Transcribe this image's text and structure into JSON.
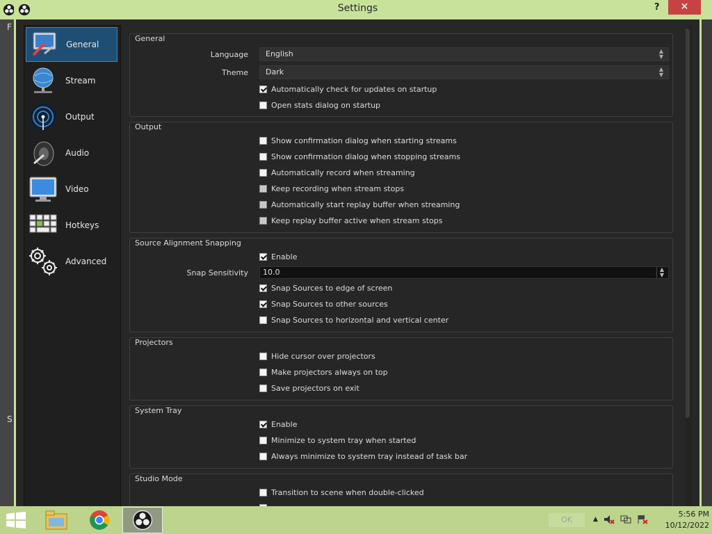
{
  "window": {
    "title": "Settings",
    "help_label": "?",
    "close_label": "✕",
    "background_menu_initial": "F",
    "background_dock_initial": "S"
  },
  "sidebar": {
    "items": [
      {
        "label": "General",
        "icon": "general-icon",
        "active": true
      },
      {
        "label": "Stream",
        "icon": "stream-globe-icon"
      },
      {
        "label": "Output",
        "icon": "output-signal-icon"
      },
      {
        "label": "Audio",
        "icon": "audio-speaker-icon"
      },
      {
        "label": "Video",
        "icon": "video-monitor-icon"
      },
      {
        "label": "Hotkeys",
        "icon": "hotkeys-keyboard-icon"
      },
      {
        "label": "Advanced",
        "icon": "advanced-gears-icon"
      }
    ]
  },
  "general": {
    "title": "General",
    "language_label": "Language",
    "language_value": "English",
    "theme_label": "Theme",
    "theme_value": "Dark",
    "check_updates": {
      "label": "Automatically check for updates on startup",
      "checked": true
    },
    "open_stats": {
      "label": "Open stats dialog on startup",
      "checked": false
    }
  },
  "output": {
    "title": "Output",
    "items": [
      {
        "label": "Show confirmation dialog when starting streams",
        "checked": false,
        "disabled": false
      },
      {
        "label": "Show confirmation dialog when stopping streams",
        "checked": false,
        "disabled": false
      },
      {
        "label": "Automatically record when streaming",
        "checked": false,
        "disabled": false
      },
      {
        "label": "Keep recording when stream stops",
        "checked": false,
        "disabled": true
      },
      {
        "label": "Automatically start replay buffer when streaming",
        "checked": false,
        "disabled": true
      },
      {
        "label": "Keep replay buffer active when stream stops",
        "checked": false,
        "disabled": true
      }
    ]
  },
  "snapping": {
    "title": "Source Alignment Snapping",
    "enable": {
      "label": "Enable",
      "checked": true
    },
    "sensitivity_label": "Snap Sensitivity",
    "sensitivity_value": "10.0",
    "items": [
      {
        "label": "Snap Sources to edge of screen",
        "checked": true
      },
      {
        "label": "Snap Sources to other sources",
        "checked": true
      },
      {
        "label": "Snap Sources to horizontal and vertical center",
        "checked": false
      }
    ]
  },
  "projectors": {
    "title": "Projectors",
    "items": [
      {
        "label": "Hide cursor over projectors",
        "checked": false
      },
      {
        "label": "Make projectors always on top",
        "checked": false
      },
      {
        "label": "Save projectors on exit",
        "checked": false
      }
    ]
  },
  "tray": {
    "title": "System Tray",
    "items": [
      {
        "label": "Enable",
        "checked": true
      },
      {
        "label": "Minimize to system tray when started",
        "checked": false
      },
      {
        "label": "Always minimize to system tray instead of task bar",
        "checked": false
      }
    ]
  },
  "studio": {
    "title": "Studio Mode",
    "items": [
      {
        "label": "Transition to scene when double-clicked",
        "checked": false
      }
    ]
  },
  "taskbar": {
    "ok_label": "OK",
    "time": "5:56 PM",
    "date": "10/12/2022",
    "apps": [
      "file-explorer-icon",
      "chrome-icon",
      "obs-icon"
    ]
  },
  "colors": {
    "accent_frame": "#c8e29a",
    "close_button": "#c74343",
    "active_nav": "#1e4e74",
    "panel_bg": "#272727"
  }
}
